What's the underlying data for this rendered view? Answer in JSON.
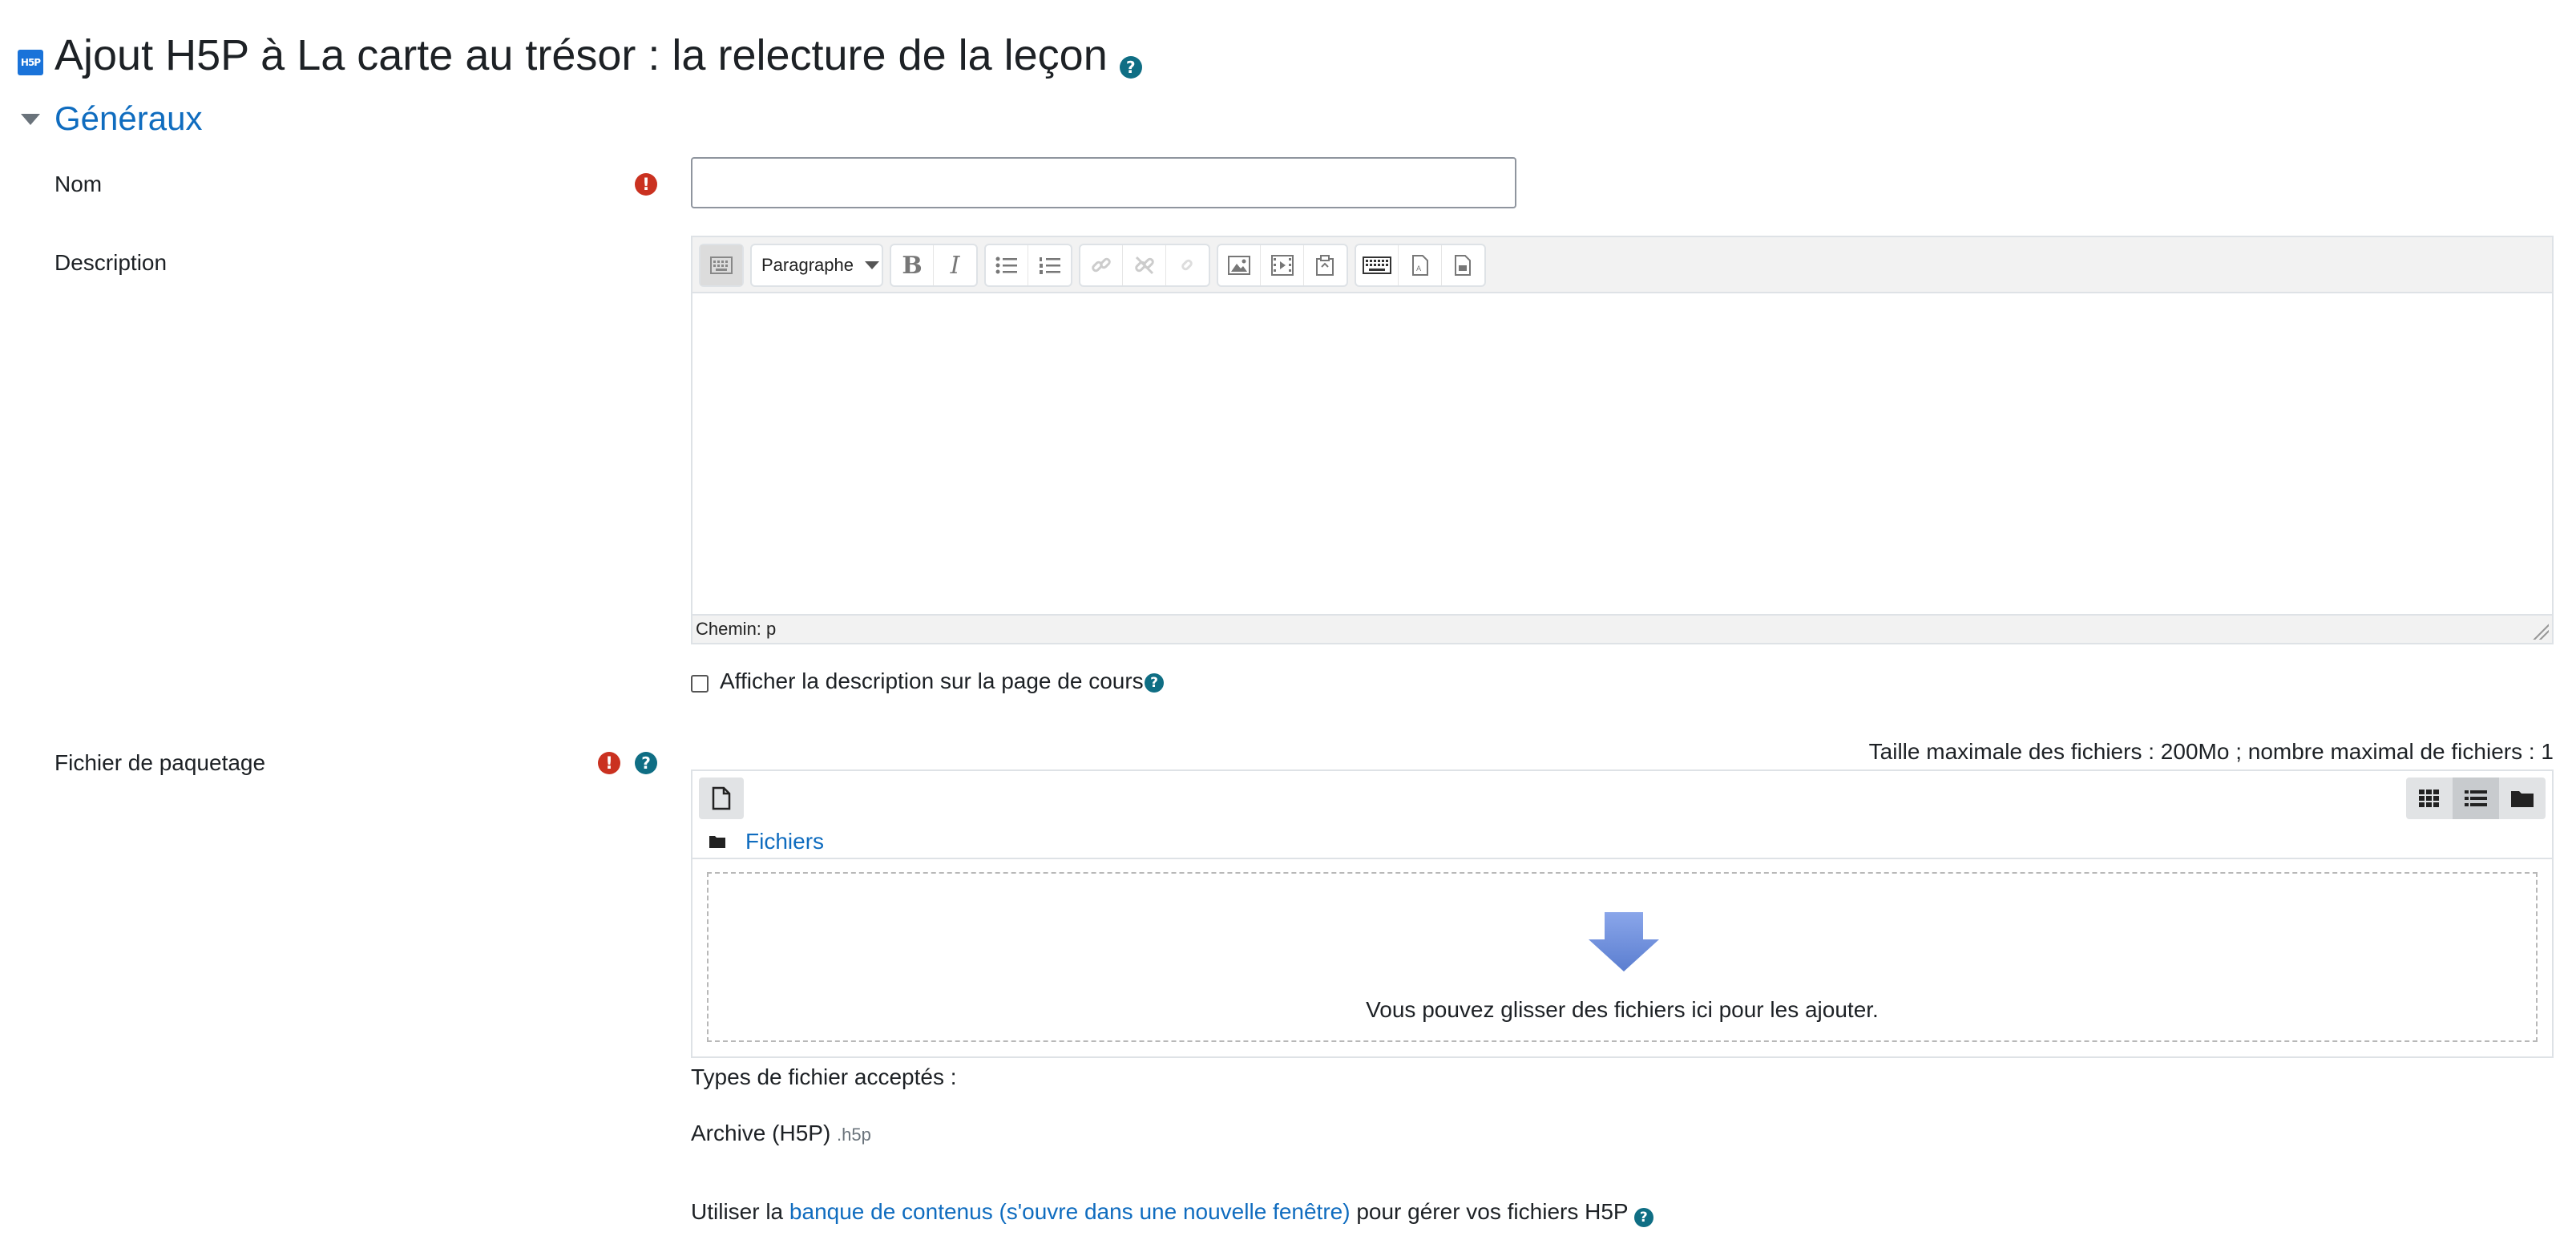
{
  "page": {
    "title": "Ajout H5P à La carte au trésor : la relecture de la leçon",
    "logo_text": "H5P",
    "help_glyph": "?"
  },
  "section": {
    "title": "Généraux"
  },
  "fields": {
    "name": {
      "label": "Nom",
      "value": "",
      "required": true
    },
    "description": {
      "label": "Description",
      "format_select": "Paragraphe",
      "statusbar": "Chemin: p",
      "toolbar_icons": [
        "keyboard-toggle-icon",
        "bold-icon",
        "italic-icon",
        "bullet-list-icon",
        "numbered-list-icon",
        "link-icon",
        "unlink-icon",
        "anchor-icon",
        "image-icon",
        "media-icon",
        "manage-files-icon",
        "accessibility-keyboard-icon",
        "accessibility-checker-icon",
        "screenreader-helper-icon"
      ]
    },
    "show_description": {
      "label": "Afficher la description sur la page de cours",
      "checked": false
    },
    "package_file": {
      "label": "Fichier de paquetage",
      "required": true,
      "limits": "Taille maximale des fichiers : 200Mo ; nombre maximal de fichiers : 1",
      "folder_link": "Fichiers",
      "drop_text": "Vous pouvez glisser des fichiers ici pour les ajouter.",
      "accepted_types_label": "Types de fichier acceptés :",
      "accepted_type_name": "Archive (H5P)",
      "accepted_type_ext": ".h5p"
    }
  },
  "content_bank": {
    "prefix": "Utiliser la",
    "link": "banque de contenus (s'ouvre dans une nouvelle fenêtre)",
    "suffix": "pour gérer vos fichiers H5P"
  },
  "colors": {
    "link": "#0f6cbf",
    "help": "#0f6e84",
    "required": "#ca3120",
    "drop_arrow": "#6f8fd9"
  }
}
